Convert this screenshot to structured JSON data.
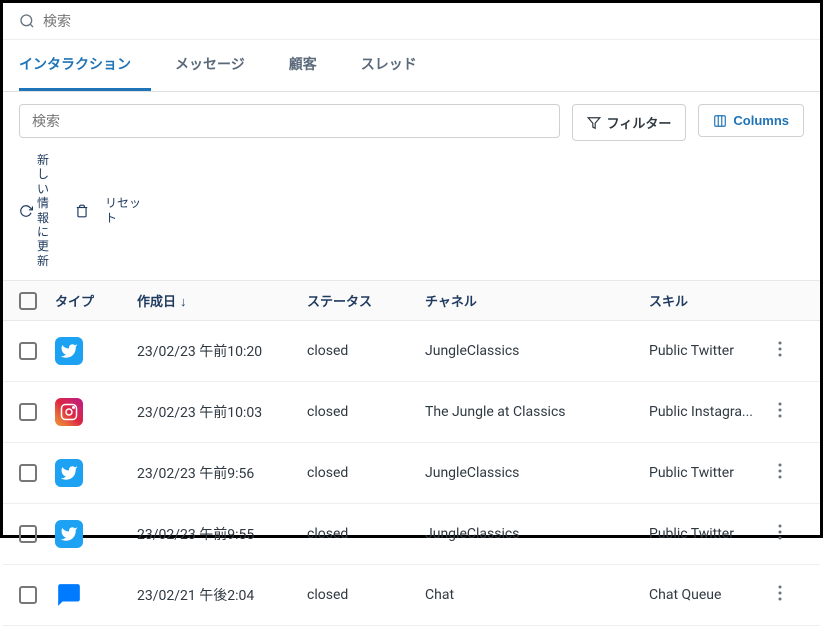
{
  "search": {
    "placeholder": "検索"
  },
  "tabs": [
    {
      "label": "インタラクション",
      "active": true
    },
    {
      "label": "メッセージ",
      "active": false
    },
    {
      "label": "顧客",
      "active": false
    },
    {
      "label": "スレッド",
      "active": false
    }
  ],
  "toolbar": {
    "search_placeholder": "検索",
    "filter_label": "フィルター",
    "columns_label": "Columns"
  },
  "actions": {
    "refresh_label": "新しい情報に更新",
    "reset_label": "リセット"
  },
  "headers": {
    "type": "タイプ",
    "date": "作成日",
    "status": "ステータス",
    "channel": "チャネル",
    "skill": "スキル"
  },
  "rows": [
    {
      "type": "twitter",
      "date": "23/02/23 午前10:20",
      "status": "closed",
      "channel": "JungleClassics",
      "skill": "Public Twitter"
    },
    {
      "type": "instagram",
      "date": "23/02/23 午前10:03",
      "status": "closed",
      "channel": "The Jungle at Classics",
      "skill": "Public Instagra..."
    },
    {
      "type": "twitter",
      "date": "23/02/23 午前9:56",
      "status": "closed",
      "channel": "JungleClassics",
      "skill": "Public Twitter"
    },
    {
      "type": "twitter",
      "date": "23/02/23 午前9:55",
      "status": "closed",
      "channel": "JungleClassics",
      "skill": "Public Twitter"
    },
    {
      "type": "chat",
      "date": "23/02/21 午後2:04",
      "status": "closed",
      "channel": "Chat",
      "skill": "Chat Queue"
    }
  ]
}
